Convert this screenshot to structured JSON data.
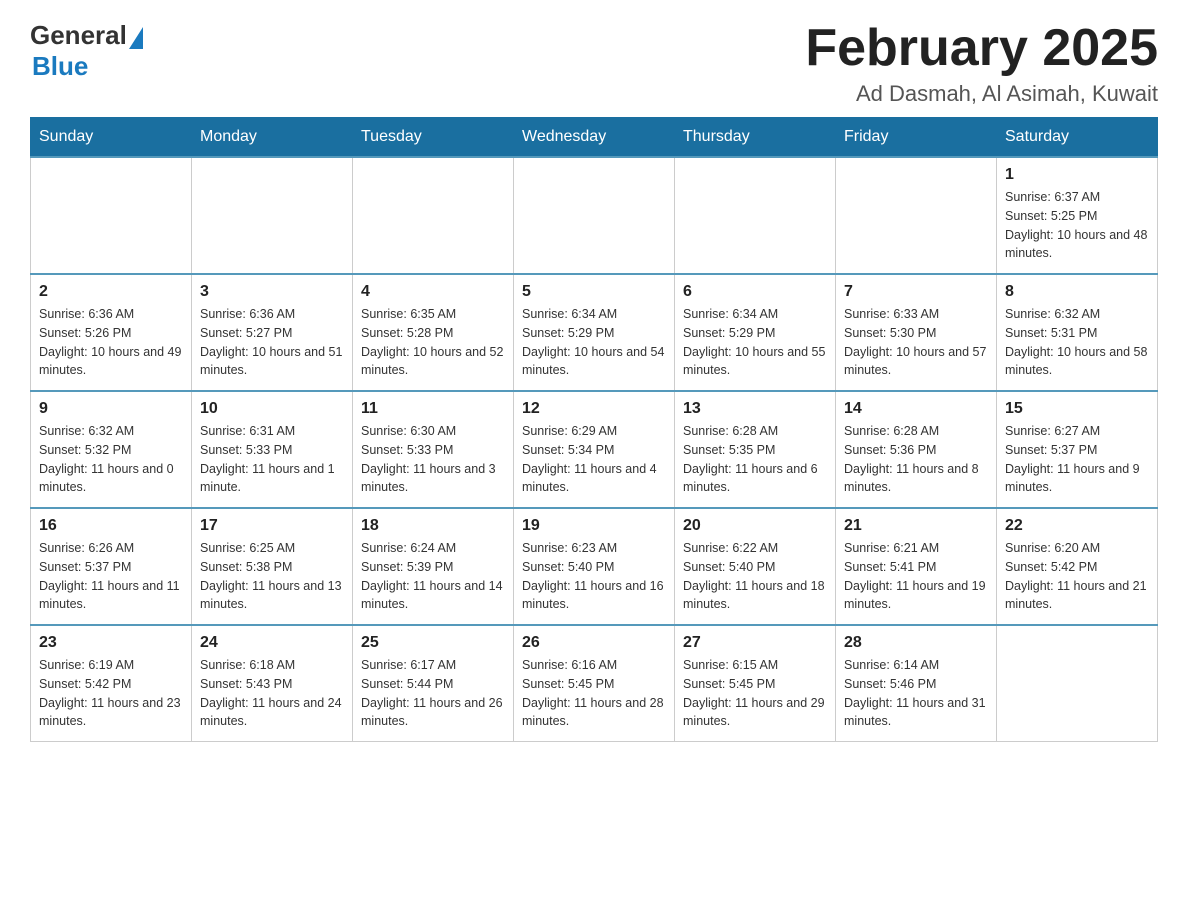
{
  "header": {
    "logo": {
      "general": "General",
      "blue": "Blue"
    },
    "title": "February 2025",
    "location": "Ad Dasmah, Al Asimah, Kuwait"
  },
  "days_of_week": [
    "Sunday",
    "Monday",
    "Tuesday",
    "Wednesday",
    "Thursday",
    "Friday",
    "Saturday"
  ],
  "weeks": [
    [
      {
        "day": "",
        "info": ""
      },
      {
        "day": "",
        "info": ""
      },
      {
        "day": "",
        "info": ""
      },
      {
        "day": "",
        "info": ""
      },
      {
        "day": "",
        "info": ""
      },
      {
        "day": "",
        "info": ""
      },
      {
        "day": "1",
        "info": "Sunrise: 6:37 AM\nSunset: 5:25 PM\nDaylight: 10 hours and 48 minutes."
      }
    ],
    [
      {
        "day": "2",
        "info": "Sunrise: 6:36 AM\nSunset: 5:26 PM\nDaylight: 10 hours and 49 minutes."
      },
      {
        "day": "3",
        "info": "Sunrise: 6:36 AM\nSunset: 5:27 PM\nDaylight: 10 hours and 51 minutes."
      },
      {
        "day": "4",
        "info": "Sunrise: 6:35 AM\nSunset: 5:28 PM\nDaylight: 10 hours and 52 minutes."
      },
      {
        "day": "5",
        "info": "Sunrise: 6:34 AM\nSunset: 5:29 PM\nDaylight: 10 hours and 54 minutes."
      },
      {
        "day": "6",
        "info": "Sunrise: 6:34 AM\nSunset: 5:29 PM\nDaylight: 10 hours and 55 minutes."
      },
      {
        "day": "7",
        "info": "Sunrise: 6:33 AM\nSunset: 5:30 PM\nDaylight: 10 hours and 57 minutes."
      },
      {
        "day": "8",
        "info": "Sunrise: 6:32 AM\nSunset: 5:31 PM\nDaylight: 10 hours and 58 minutes."
      }
    ],
    [
      {
        "day": "9",
        "info": "Sunrise: 6:32 AM\nSunset: 5:32 PM\nDaylight: 11 hours and 0 minutes."
      },
      {
        "day": "10",
        "info": "Sunrise: 6:31 AM\nSunset: 5:33 PM\nDaylight: 11 hours and 1 minute."
      },
      {
        "day": "11",
        "info": "Sunrise: 6:30 AM\nSunset: 5:33 PM\nDaylight: 11 hours and 3 minutes."
      },
      {
        "day": "12",
        "info": "Sunrise: 6:29 AM\nSunset: 5:34 PM\nDaylight: 11 hours and 4 minutes."
      },
      {
        "day": "13",
        "info": "Sunrise: 6:28 AM\nSunset: 5:35 PM\nDaylight: 11 hours and 6 minutes."
      },
      {
        "day": "14",
        "info": "Sunrise: 6:28 AM\nSunset: 5:36 PM\nDaylight: 11 hours and 8 minutes."
      },
      {
        "day": "15",
        "info": "Sunrise: 6:27 AM\nSunset: 5:37 PM\nDaylight: 11 hours and 9 minutes."
      }
    ],
    [
      {
        "day": "16",
        "info": "Sunrise: 6:26 AM\nSunset: 5:37 PM\nDaylight: 11 hours and 11 minutes."
      },
      {
        "day": "17",
        "info": "Sunrise: 6:25 AM\nSunset: 5:38 PM\nDaylight: 11 hours and 13 minutes."
      },
      {
        "day": "18",
        "info": "Sunrise: 6:24 AM\nSunset: 5:39 PM\nDaylight: 11 hours and 14 minutes."
      },
      {
        "day": "19",
        "info": "Sunrise: 6:23 AM\nSunset: 5:40 PM\nDaylight: 11 hours and 16 minutes."
      },
      {
        "day": "20",
        "info": "Sunrise: 6:22 AM\nSunset: 5:40 PM\nDaylight: 11 hours and 18 minutes."
      },
      {
        "day": "21",
        "info": "Sunrise: 6:21 AM\nSunset: 5:41 PM\nDaylight: 11 hours and 19 minutes."
      },
      {
        "day": "22",
        "info": "Sunrise: 6:20 AM\nSunset: 5:42 PM\nDaylight: 11 hours and 21 minutes."
      }
    ],
    [
      {
        "day": "23",
        "info": "Sunrise: 6:19 AM\nSunset: 5:42 PM\nDaylight: 11 hours and 23 minutes."
      },
      {
        "day": "24",
        "info": "Sunrise: 6:18 AM\nSunset: 5:43 PM\nDaylight: 11 hours and 24 minutes."
      },
      {
        "day": "25",
        "info": "Sunrise: 6:17 AM\nSunset: 5:44 PM\nDaylight: 11 hours and 26 minutes."
      },
      {
        "day": "26",
        "info": "Sunrise: 6:16 AM\nSunset: 5:45 PM\nDaylight: 11 hours and 28 minutes."
      },
      {
        "day": "27",
        "info": "Sunrise: 6:15 AM\nSunset: 5:45 PM\nDaylight: 11 hours and 29 minutes."
      },
      {
        "day": "28",
        "info": "Sunrise: 6:14 AM\nSunset: 5:46 PM\nDaylight: 11 hours and 31 minutes."
      },
      {
        "day": "",
        "info": ""
      }
    ]
  ]
}
